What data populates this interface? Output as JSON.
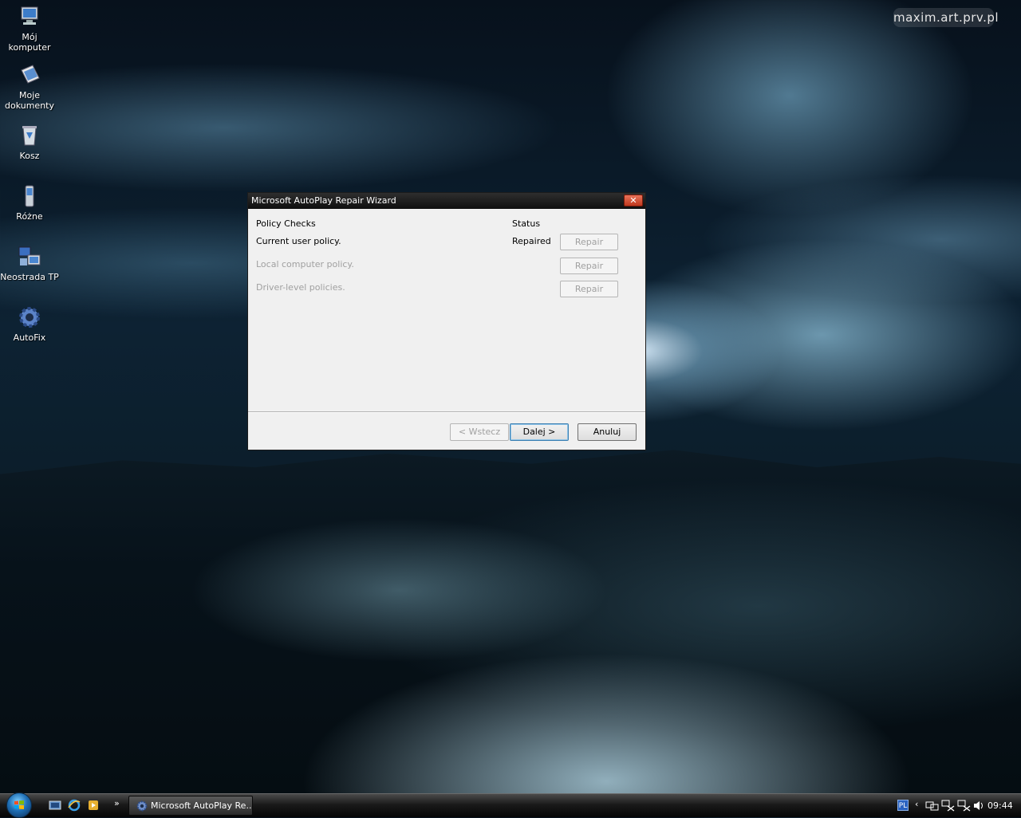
{
  "watermark": "maxim.art.prv.pl",
  "desktop_icons": [
    {
      "label": "Mój komputer",
      "icon": "computer-icon"
    },
    {
      "label": "Moje\ndokumenty",
      "icon": "documents-icon"
    },
    {
      "label": "Kosz",
      "icon": "recycle-bin-icon"
    },
    {
      "label": "Różne",
      "icon": "phone-icon"
    },
    {
      "label": "Neostrada TP",
      "icon": "network-icon"
    },
    {
      "label": "AutoFix",
      "icon": "gear-icon"
    }
  ],
  "dialog": {
    "title": "Microsoft AutoPlay Repair Wizard",
    "close_label": "✕",
    "header_policy": "Policy Checks",
    "header_status": "Status",
    "rows": [
      {
        "label": "Current user policy.",
        "status": "Repaired",
        "button": "Repair",
        "enabled": true
      },
      {
        "label": "Local computer policy.",
        "status": "",
        "button": "Repair",
        "enabled": false
      },
      {
        "label": "Driver-level policies.",
        "status": "",
        "button": "Repair",
        "enabled": false
      }
    ],
    "back_label": "< Wstecz",
    "next_label": "Dalej >",
    "cancel_label": "Anuluj"
  },
  "taskbar": {
    "chevron": "»",
    "task_label": "Microsoft AutoPlay Re...",
    "lang": "PL",
    "tray_arrow": "‹",
    "clock": "09:44"
  }
}
